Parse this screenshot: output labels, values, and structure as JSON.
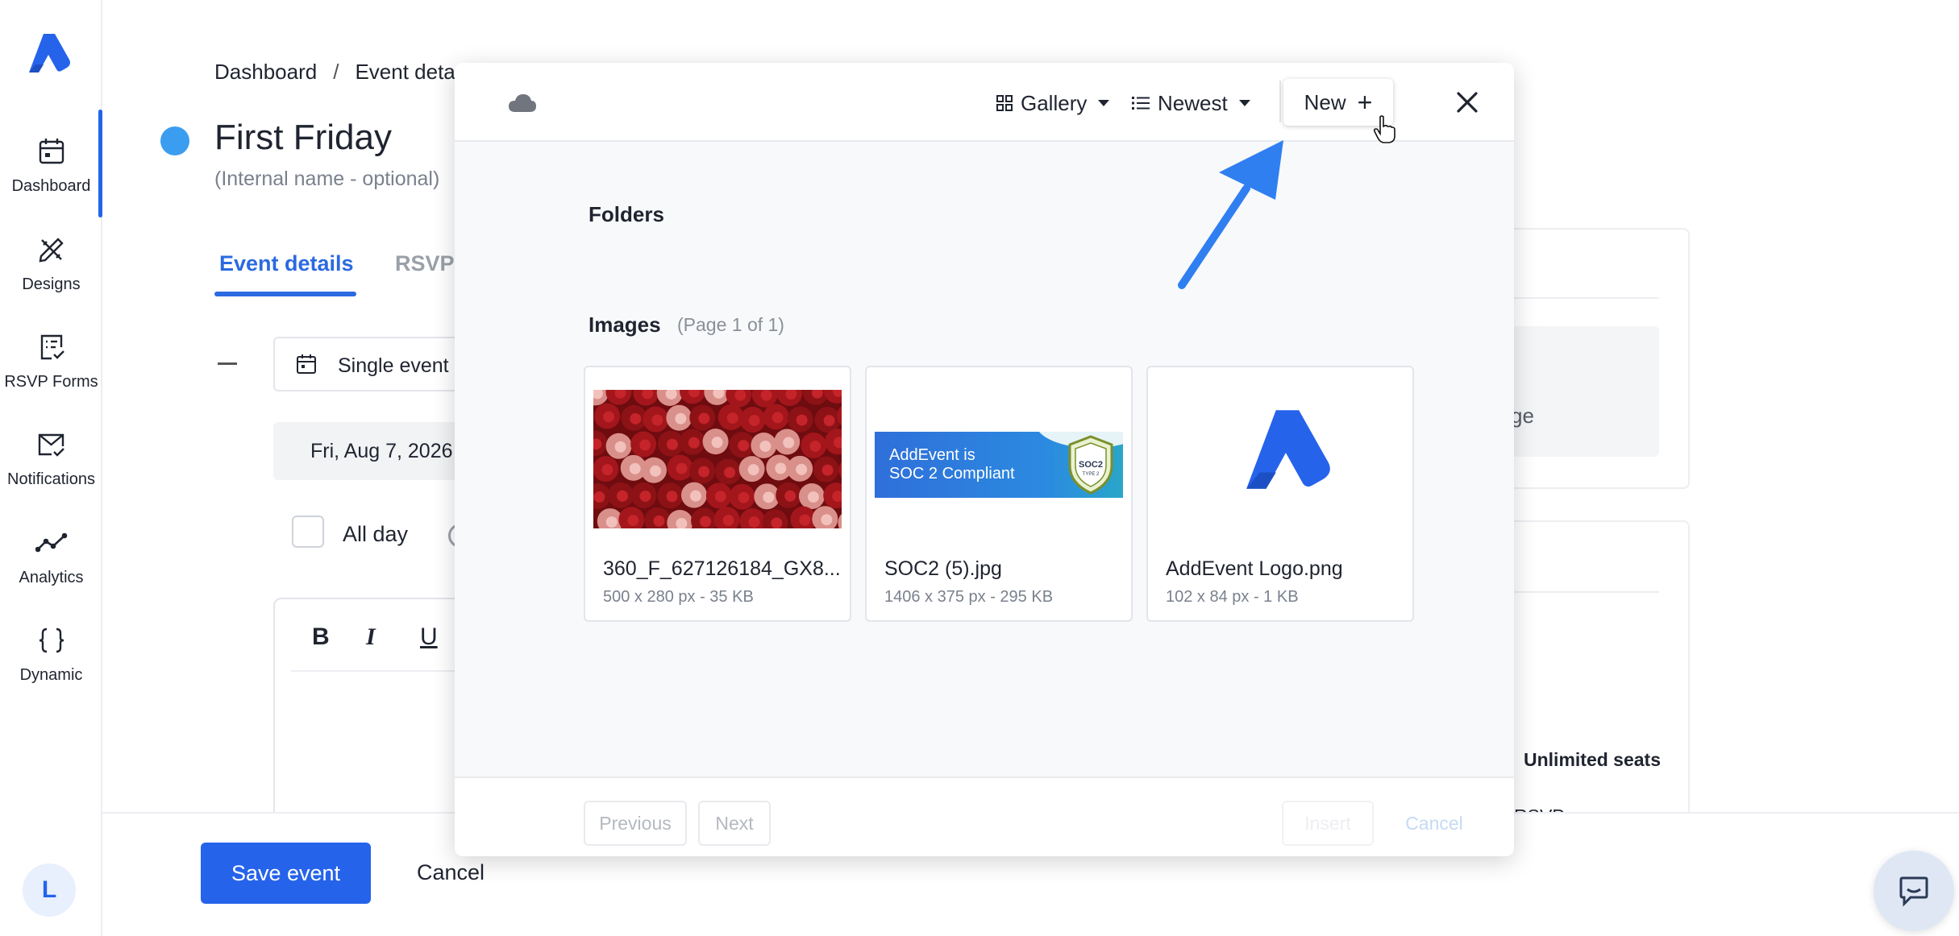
{
  "sidebar": {
    "items": [
      {
        "label": "Dashboard",
        "icon": "calendar-icon",
        "active": true
      },
      {
        "label": "Designs",
        "icon": "pen-ruler-icon"
      },
      {
        "label": "RSVP Forms",
        "icon": "form-check-icon"
      },
      {
        "label": "Notifications",
        "icon": "mail-check-icon"
      },
      {
        "label": "Analytics",
        "icon": "line-chart-icon"
      },
      {
        "label": "Dynamic",
        "icon": "braces-icon"
      }
    ],
    "avatar_initial": "L",
    "accent": "#2563eb"
  },
  "page": {
    "breadcrumb": [
      "Dashboard",
      "Event deta"
    ],
    "breadcrumb_separator": "/",
    "title": "First Friday",
    "subtitle": "(Internal name - optional)",
    "tabs": [
      {
        "label": "Event details",
        "active": true
      },
      {
        "label": "RSVP"
      }
    ],
    "event_type": "Single event",
    "date": "Fri, Aug 7, 2026",
    "all_day_label": "All day",
    "editor_buttons": [
      "B",
      "I",
      "U"
    ],
    "right_panel_partial": "ge",
    "seats_label": "Unlimited seats",
    "rsvps_partial": "RSVPs"
  },
  "footer": {
    "save_label": "Save event",
    "cancel_label": "Cancel"
  },
  "modal": {
    "view_label": "Gallery",
    "sort_label": "Newest",
    "new_label": "New",
    "folders_heading": "Folders",
    "images_heading": "Images",
    "page_info": "(Page 1 of 1)",
    "images": [
      {
        "name": "360_F_627126184_GX8...",
        "meta": "500 x 280 px - 35 KB"
      },
      {
        "name": "SOC2 (5).jpg",
        "meta": "1406 x 375 px - 295 KB",
        "banner_line1": "AddEvent is",
        "banner_line2": "SOC 2 Compliant",
        "badge_line1": "SOC2",
        "badge_line2": "TYPE 2"
      },
      {
        "name": "AddEvent Logo.png",
        "meta": "102 x 84 px - 1 KB"
      }
    ],
    "previous_label": "Previous",
    "next_label": "Next",
    "insert_label": "Insert",
    "cancel_label": "Cancel"
  },
  "colors": {
    "brand_blue": "#2563eb",
    "status_dot": "#3b9df0",
    "annotation_arrow": "#2f7ff0"
  }
}
